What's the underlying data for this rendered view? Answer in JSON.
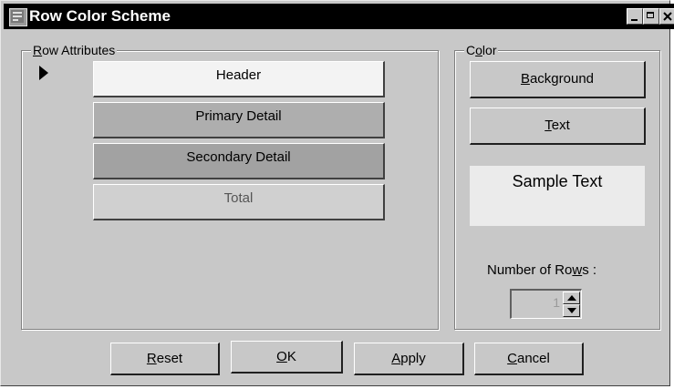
{
  "window": {
    "title": "Row Color Scheme",
    "app_icon": "document-list-icon",
    "controls": [
      "minimize-icon",
      "maximize-icon",
      "close-icon"
    ]
  },
  "row_attributes": {
    "group_label_mnemonic": "R",
    "group_label_rest": "ow Attributes",
    "selected_index": 0,
    "rows": [
      {
        "label": "Header",
        "bg": "#f3f3f3",
        "fg": "#000000"
      },
      {
        "label": "Primary Detail",
        "bg": "#aeaeae",
        "fg": "#000000"
      },
      {
        "label": "Secondary Detail",
        "bg": "#a2a2a2",
        "fg": "#000000"
      },
      {
        "label": "Total",
        "bg": "#d0d0d0",
        "fg": "#555555"
      }
    ]
  },
  "color": {
    "group_label_pre": "C",
    "group_label_mnemonic": "o",
    "group_label_rest": "lor",
    "background_mnemonic": "B",
    "background_rest": "ackground",
    "text_mnemonic": "T",
    "text_rest": "ext",
    "sample_text": "Sample Text",
    "rows_label_pre": "Number of Ro",
    "rows_label_mnemonic": "w",
    "rows_label_rest": "s :",
    "rows_value": "1"
  },
  "buttons": {
    "reset_mnemonic": "R",
    "reset_rest": "eset",
    "ok_mnemonic": "O",
    "ok_rest": "K",
    "apply_mnemonic": "A",
    "apply_rest": "pply",
    "cancel_mnemonic": "C",
    "cancel_rest": "ancel"
  },
  "colors": {
    "titlebar": "#000000",
    "dialog_bg": "#c8c8c8",
    "sample_bg": "#ebebeb"
  }
}
